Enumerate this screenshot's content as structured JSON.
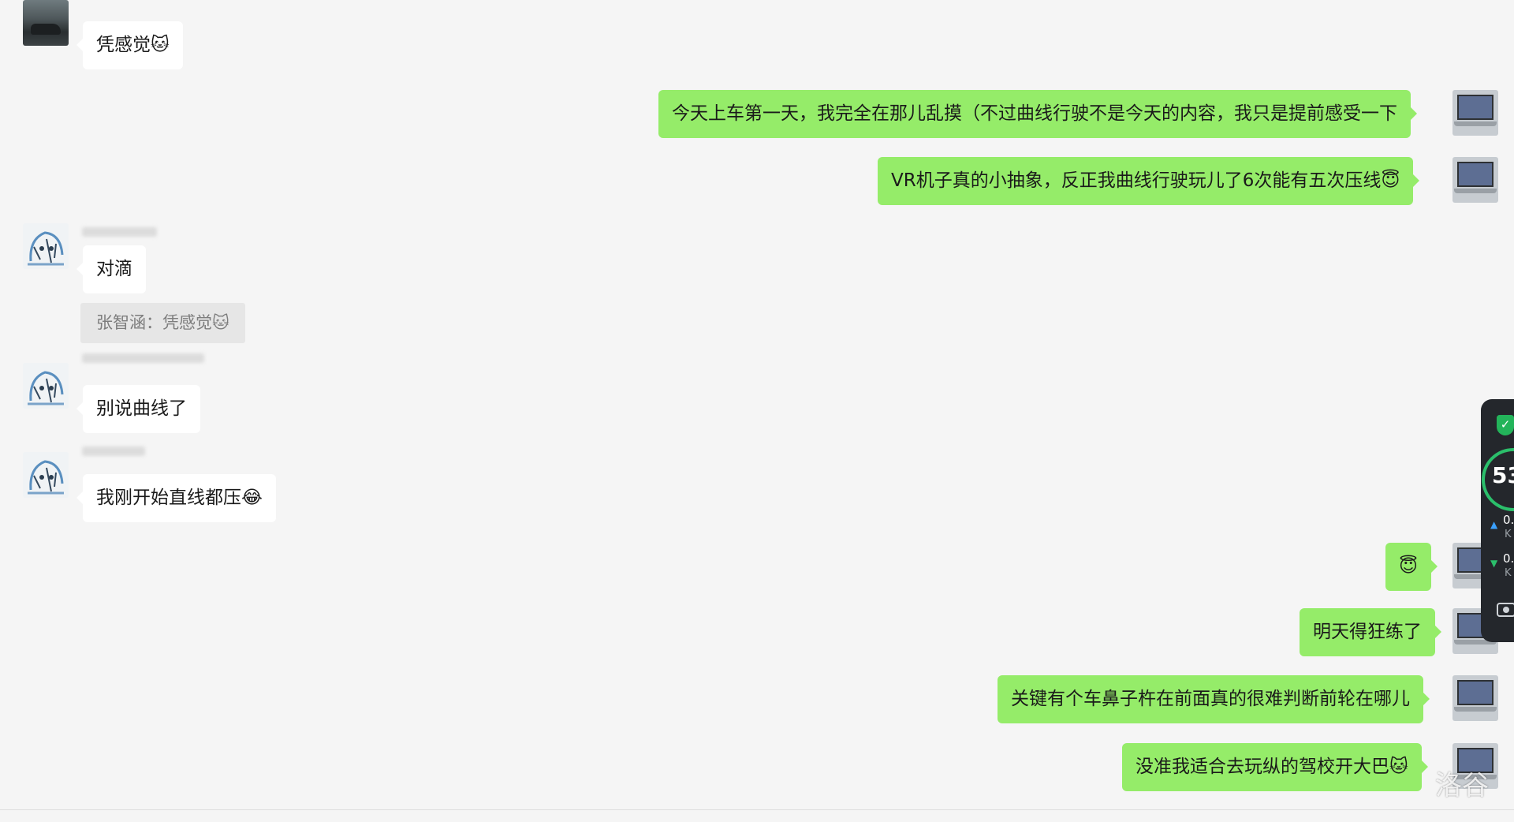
{
  "messages": [
    {
      "text": "凭感觉🐱"
    },
    {
      "text": "今天上车第一天，我完全在那儿乱摸（不过曲线行驶不是今天的内容，我只是提前感受一下"
    },
    {
      "text": "VR机子真的小抽象，反正我曲线行驶玩儿了6次能有五次压线😇"
    },
    {
      "text": "对滴"
    },
    {
      "text": "张智涵：凭感觉🐱"
    },
    {
      "text": "别说曲线了"
    },
    {
      "text": "我刚开始直线都压😂"
    },
    {
      "text": "😇"
    },
    {
      "text": "明天得狂练了"
    },
    {
      "text": "关键有个车鼻子杵在前面真的很难判断前轮在哪儿"
    },
    {
      "text": "没准我适合去玩纵的驾校开大巴🐱"
    }
  ],
  "speed_widget": {
    "value": "53",
    "upload_value": "0.",
    "upload_unit": "K",
    "download_value": "0.",
    "download_unit": "K",
    "shield_icon": "shield-check-icon",
    "camera_icon": "camera-icon"
  },
  "watermark": "洛谷"
}
